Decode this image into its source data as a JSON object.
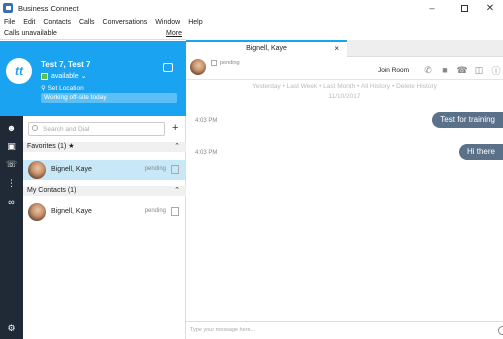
{
  "window": {
    "title": "Business Connect",
    "min": "–",
    "close": "✕"
  },
  "menu": [
    "File",
    "Edit",
    "Contacts",
    "Calls",
    "Conversations",
    "Window",
    "Help"
  ],
  "status_bar": {
    "text": "Calls unavailable",
    "more": "More"
  },
  "profile": {
    "initials": "tt",
    "name": "Test 7, Test 7",
    "status": "available ⌄",
    "location": "⚲ Set Location",
    "note": "Working off-site today"
  },
  "search": {
    "placeholder": "Search and Dial",
    "add": "+"
  },
  "groups": [
    {
      "label": "Favorites (1) ★",
      "chevron": "⌃"
    },
    {
      "label": "My Contacts (1)",
      "chevron": "⌃"
    }
  ],
  "contacts": [
    {
      "name": "Bignell, Kaye",
      "status": "pending"
    },
    {
      "name": "Bignell, Kaye",
      "status": "pending"
    }
  ],
  "tab": {
    "label": "Bignell, Kaye",
    "close": "×"
  },
  "chat_header": {
    "status": "pending",
    "join_room": "Join Room"
  },
  "history": {
    "links": [
      "Yesterday",
      "Last Week",
      "Last Month",
      "All History",
      "Delete History"
    ],
    "separator": "•",
    "date": "11/10/2017"
  },
  "messages": [
    {
      "time": "4:03 PM",
      "text": "Test for training"
    },
    {
      "time": "4:03 PM",
      "text": "Hi there"
    }
  ],
  "composer": {
    "placeholder": "Type your message here..."
  },
  "colors": {
    "accent": "#1aa3f0",
    "bubble": "#5b7189",
    "rail": "#1f2a36",
    "selected_row": "#c8e8f7"
  }
}
